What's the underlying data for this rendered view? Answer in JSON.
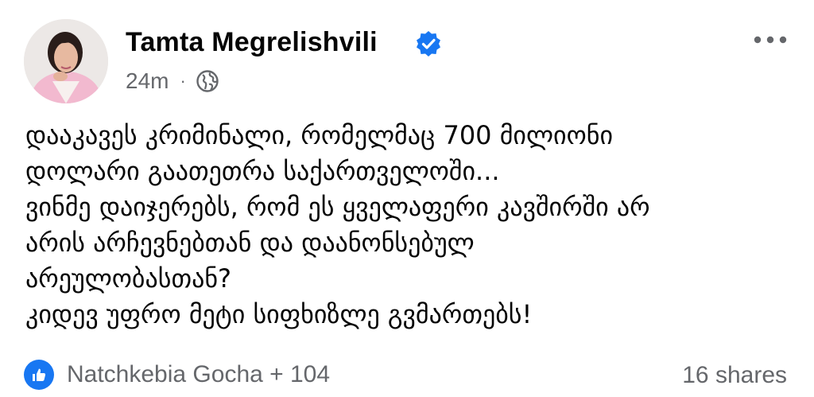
{
  "post": {
    "author": "Tamta Megrelishvili",
    "verified_icon": "verified-badge-icon",
    "time": "24m",
    "separator": "·",
    "audience_icon": "globe-icon",
    "more_icon": "more-options-icon",
    "text_lines": [
      "დააკავეს კრიმინალი, რომელმაც 700 მილიონი",
      "დოლარი გაათეთრა საქართველოში...",
      "ვინმე დაიჯერებს, რომ ეს ყველაფერი კავშირში არ",
      "არის არჩევნებთან და დაანონსებულ",
      "არეულობასთან?",
      "კიდევ უფრო მეტი სიფხიზლე გვმართებს!"
    ]
  },
  "footer": {
    "reaction_icon": "like-icon",
    "reactions_text": "Natchkebia Gocha + 104",
    "shares_text": "16 shares"
  },
  "colors": {
    "accent": "#1877f2",
    "secondary_text": "#65676b",
    "primary_text": "#050505"
  }
}
